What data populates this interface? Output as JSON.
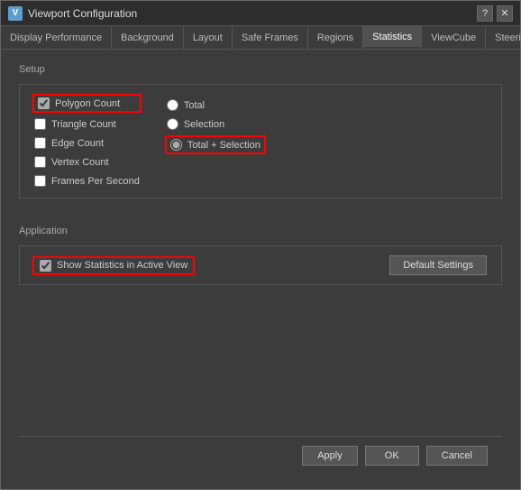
{
  "dialog": {
    "title": "Viewport Configuration",
    "icon": "V"
  },
  "tabs": [
    {
      "label": "Display Performance",
      "active": false
    },
    {
      "label": "Background",
      "active": false
    },
    {
      "label": "Layout",
      "active": false
    },
    {
      "label": "Safe Frames",
      "active": false
    },
    {
      "label": "Regions",
      "active": false
    },
    {
      "label": "Statistics",
      "active": true
    },
    {
      "label": "ViewCube",
      "active": false
    },
    {
      "label": "SteeringWheels",
      "active": false
    }
  ],
  "setup": {
    "label": "Setup",
    "checkboxes": [
      {
        "id": "polygon-count",
        "label": "Polygon Count",
        "checked": true,
        "highlighted": true
      },
      {
        "id": "triangle-count",
        "label": "Triangle Count",
        "checked": false,
        "highlighted": false
      },
      {
        "id": "edge-count",
        "label": "Edge Count",
        "checked": false,
        "highlighted": false
      },
      {
        "id": "vertex-count",
        "label": "Vertex Count",
        "checked": false,
        "highlighted": false
      },
      {
        "id": "frames-per-second",
        "label": "Frames Per Second",
        "checked": false,
        "highlighted": false
      }
    ],
    "radios": [
      {
        "id": "total",
        "label": "Total",
        "checked": false,
        "highlighted": false
      },
      {
        "id": "selection",
        "label": "Selection",
        "checked": false,
        "highlighted": false
      },
      {
        "id": "total-plus-selection",
        "label": "Total + Selection",
        "checked": true,
        "highlighted": true
      }
    ]
  },
  "application": {
    "label": "Application",
    "show_stats": {
      "label": "Show Statistics in Active View",
      "checked": true,
      "highlighted": true
    },
    "default_button": "Default Settings"
  },
  "footer": {
    "apply": "Apply",
    "ok": "OK",
    "cancel": "Cancel"
  }
}
